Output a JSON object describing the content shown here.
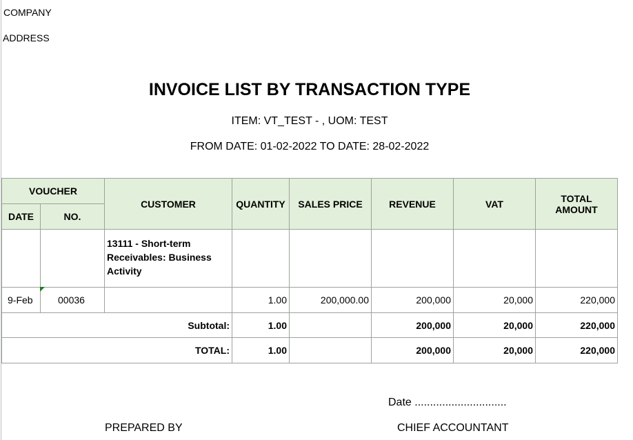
{
  "company_label": "COMPANY",
  "address_label": "ADDRESS",
  "title": "INVOICE LIST BY TRANSACTION TYPE",
  "item_line": "ITEM: VT_TEST - , UOM: TEST",
  "date_range": "FROM DATE: 01-02-2022 TO DATE: 28-02-2022",
  "headers": {
    "voucher": "VOUCHER",
    "date": "DATE",
    "no": "NO.",
    "customer": "CUSTOMER",
    "quantity": "QUANTITY",
    "sales_price": "SALES PRICE",
    "revenue": "REVENUE",
    "vat": "VAT",
    "total_amount_1": "TOTAL",
    "total_amount_2": "AMOUNT"
  },
  "group": {
    "customer": "13111 - Short-term Receivables: Business Activity"
  },
  "rows": [
    {
      "date": "9-Feb",
      "no": "00036",
      "quantity": "1.00",
      "sales_price": "200,000.00",
      "revenue": "200,000",
      "vat": "20,000",
      "total": "220,000"
    }
  ],
  "subtotal": {
    "label": "Subtotal:",
    "quantity": "1.00",
    "revenue": "200,000",
    "vat": "20,000",
    "total": "220,000"
  },
  "total": {
    "label": "TOTAL:",
    "quantity": "1.00",
    "revenue": "200,000",
    "vat": "20,000",
    "total": "220,000"
  },
  "footer": {
    "date_line": "Date ..............................",
    "prepared_by": "PREPARED BY",
    "chief_accountant": "CHIEF ACCOUNTANT"
  },
  "colors": {
    "header_bg": "#e2efda",
    "grid_line": "#9aa39a",
    "note_marker": "#1e7b1e"
  }
}
